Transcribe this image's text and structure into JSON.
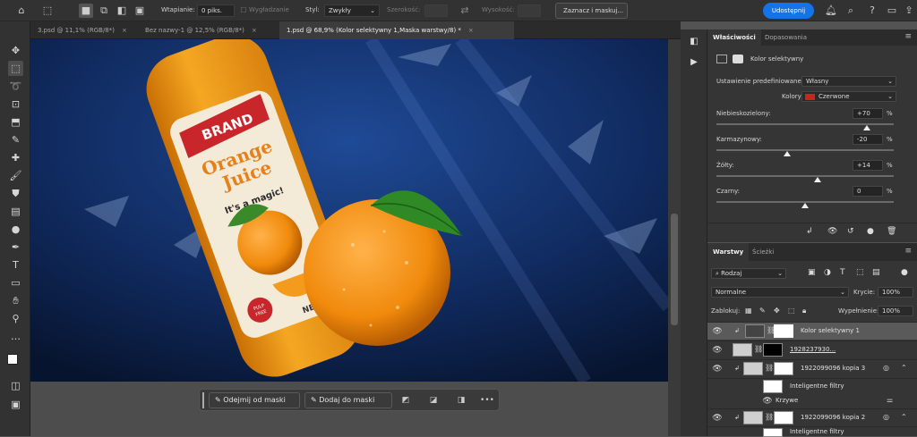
{
  "option_bar": {
    "feather_label": "Wtapianie:",
    "feather_value": "0 piks.",
    "smooth_label": "Wygładzanie",
    "style_label": "Styl:",
    "style_value": "Zwykły",
    "width_label": "Szerokość:",
    "height_label": "Wysokość:",
    "select_mask_label": "Zaznacz i maskuj...",
    "share_label": "Udostępnij"
  },
  "tabs": [
    {
      "label": "3.psd @ 11,1% (RGB/8*)"
    },
    {
      "label": "Bez nazwy-1 @ 12,5% (RGB/8*)"
    },
    {
      "label": "1.psd @ 68,9% (Kolor selektywny 1,Maska warstwy/8) *"
    }
  ],
  "canvas_art": {
    "brand": "BRAND",
    "title_line1": "Orange",
    "title_line2": "Juice",
    "tagline": "It's a magic!",
    "badge_line1": "PULP",
    "badge_line2": "FREE",
    "net": "NET WT"
  },
  "context_bar": {
    "subtract_label": "Odejmij od maski",
    "add_label": "Dodaj do maski",
    "more_label": "•••"
  },
  "properties": {
    "tab_properties": "Właściwości",
    "tab_adjustments": "Dopasowania",
    "title": "Kolor selektywny",
    "preset_label": "Ustawienie predefiniowane:",
    "preset_value": "Własny",
    "colors_label": "Kolory:",
    "colors_value": "Czerwone",
    "colors_swatch": "#c4281c",
    "sliders": [
      {
        "label": "Niebieskozielony:",
        "value": "+70",
        "level": 70
      },
      {
        "label": "Karmazynowy:",
        "value": "-20",
        "level": -20
      },
      {
        "label": "Żółty:",
        "value": "+14",
        "level": 14
      },
      {
        "label": "Czarny:",
        "value": "0",
        "level": 0
      }
    ],
    "unit": "%"
  },
  "layers": {
    "tab_layers": "Warstwy",
    "tab_paths": "Ścieżki",
    "filter_kind": "Rodzaj",
    "blend_mode": "Normalne",
    "opacity_label": "Krycie:",
    "opacity_value": "100%",
    "lock_label": "Zablokuj:",
    "fill_label": "Wypełnienie:",
    "fill_value": "100%",
    "rows": [
      {
        "name": "Kolor selektywny 1"
      },
      {
        "name": "1928237930..."
      },
      {
        "name": "1922099096 kopia 3"
      },
      {
        "name": "Inteligentne filtry"
      },
      {
        "name": "Krzywe"
      },
      {
        "name": "1922099096 kopia 2"
      },
      {
        "name": "Inteligentne filtry"
      }
    ]
  }
}
